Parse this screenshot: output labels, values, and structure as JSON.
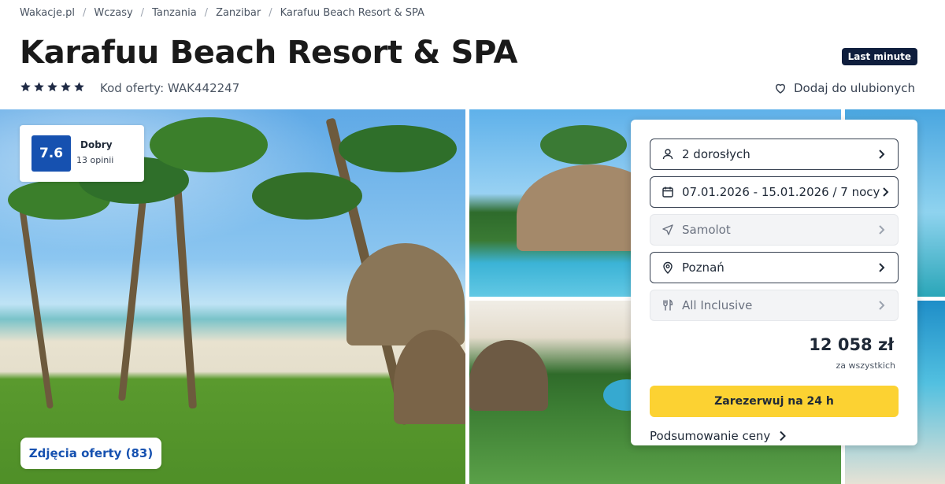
{
  "breadcrumb": [
    "Wakacje.pl",
    "Wczasy",
    "Tanzania",
    "Zanzibar",
    "Karafuu Beach Resort & SPA"
  ],
  "breadcrumb_separator": "/",
  "hotel": {
    "title": "Karafuu Beach Resort & SPA",
    "stars": 5,
    "offer_code": "Kod oferty: WAK442247",
    "badge": "Last minute",
    "favorite_label": "Dodaj do ulubionych"
  },
  "rating": {
    "score": "7.6",
    "label": "Dobry",
    "count": "13 opinii"
  },
  "gallery": {
    "photos_button": "Zdjęcia oferty (83)"
  },
  "booking": {
    "fields": [
      {
        "label": "2 dorosłych",
        "icon": "person-icon",
        "state": "active"
      },
      {
        "label": "07.01.2026 - 15.01.2026 / 7 nocy",
        "icon": "calendar-icon",
        "state": "active"
      },
      {
        "label": "Samolot",
        "icon": "plane-icon",
        "state": "disabled"
      },
      {
        "label": "Poznań",
        "icon": "location-pin-icon",
        "state": "active"
      },
      {
        "label": "All Inclusive",
        "icon": "cutlery-icon",
        "state": "disabled"
      }
    ],
    "price": "12 058 zł",
    "price_note": "za wszystkich",
    "book_button": "Zarezerwuj na 24 h",
    "summary_link": "Podsumowanie ceny"
  },
  "colors": {
    "accent_blue": "#1651b0",
    "badge_navy": "#0f1e3d",
    "book_yellow": "#fcd232"
  }
}
